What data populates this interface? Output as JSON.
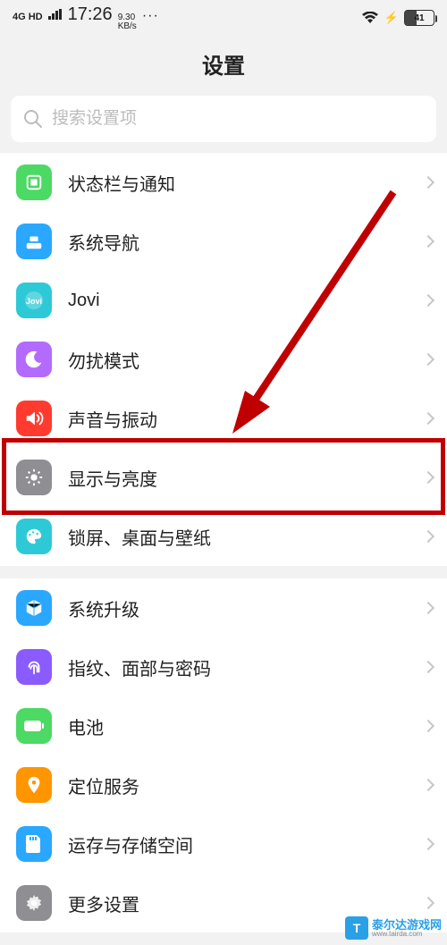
{
  "status": {
    "signal": "4G HD",
    "time": "17:26",
    "net_speed": "9.30",
    "net_unit": "KB/s",
    "more": "···",
    "battery_pct": 41,
    "battery_text": "41"
  },
  "title": "设置",
  "search": {
    "placeholder": "搜索设置项"
  },
  "groups": [
    {
      "items": [
        {
          "id": "status-notif",
          "label": "状态栏与通知",
          "icon": "notif-icon",
          "bg": "#4cd964"
        },
        {
          "id": "system-nav",
          "label": "系统导航",
          "icon": "nav-icon",
          "bg": "#2aa7ff"
        },
        {
          "id": "jovi",
          "label": "Jovi",
          "icon": "jovi-icon",
          "bg": "#2ec9d6"
        },
        {
          "id": "dnd",
          "label": "勿扰模式",
          "icon": "moon-icon",
          "bg": "#b36bff"
        },
        {
          "id": "sound",
          "label": "声音与振动",
          "icon": "sound-icon",
          "bg": "#ff3b30"
        },
        {
          "id": "display",
          "label": "显示与亮度",
          "icon": "bright-icon",
          "bg": "#8e8e93"
        },
        {
          "id": "lockscreen",
          "label": "锁屏、桌面与壁纸",
          "icon": "palette-icon",
          "bg": "#2ec9d6"
        }
      ]
    },
    {
      "items": [
        {
          "id": "system-update",
          "label": "系统升级",
          "icon": "cube-icon",
          "bg": "#2aa7ff"
        },
        {
          "id": "biometrics",
          "label": "指纹、面部与密码",
          "icon": "fingerprint-icon",
          "bg": "#8a5cff"
        },
        {
          "id": "battery",
          "label": "电池",
          "icon": "battery-icon",
          "bg": "#4cd964"
        },
        {
          "id": "location",
          "label": "定位服务",
          "icon": "location-icon",
          "bg": "#ff9500"
        },
        {
          "id": "storage",
          "label": "运存与存储空间",
          "icon": "sd-icon",
          "bg": "#2aa7ff"
        },
        {
          "id": "more",
          "label": "更多设置",
          "icon": "gear-icon",
          "bg": "#8e8e93"
        }
      ]
    }
  ],
  "watermark": {
    "logo": "T",
    "cn": "泰尔达游戏网",
    "en": "www.tairda.com"
  },
  "colors": {
    "highlight": "#c00000"
  }
}
